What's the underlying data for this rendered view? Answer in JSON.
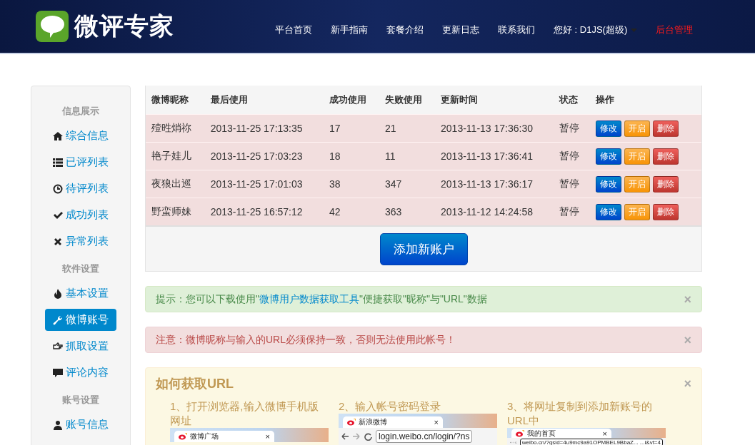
{
  "header": {
    "logo_text": "微评专家",
    "nav": [
      {
        "label": "平台首页",
        "kind": "link"
      },
      {
        "label": "新手指南",
        "kind": "link"
      },
      {
        "label": "套餐介绍",
        "kind": "link"
      },
      {
        "label": "更新日志",
        "kind": "link"
      },
      {
        "label": "联系我们",
        "kind": "link"
      },
      {
        "label": "您好 : D1JS(超级)",
        "kind": "user"
      },
      {
        "label": "后台管理",
        "kind": "admin"
      }
    ]
  },
  "sidebar": [
    {
      "heading": "信息展示",
      "items": [
        {
          "label": "综合信息",
          "kind": "home",
          "selected": false
        },
        {
          "label": "已评列表",
          "kind": "list",
          "selected": false
        },
        {
          "label": "待评列表",
          "kind": "clock",
          "selected": false
        },
        {
          "label": "成功列表",
          "kind": "check",
          "selected": false
        },
        {
          "label": "异常列表",
          "kind": "times",
          "selected": false
        }
      ]
    },
    {
      "heading": "软件设置",
      "items": [
        {
          "label": "基本设置",
          "kind": "fire",
          "selected": false
        },
        {
          "label": "微博账号",
          "kind": "wrench",
          "selected": true
        },
        {
          "label": "抓取设置",
          "kind": "hand",
          "selected": false
        },
        {
          "label": "评论内容",
          "kind": "comment",
          "selected": false
        }
      ]
    },
    {
      "heading": "账号设置",
      "items": [
        {
          "label": "账号信息",
          "kind": "user",
          "selected": false
        }
      ]
    }
  ],
  "table": {
    "columns": [
      "微博昵称",
      "最后使用",
      "成功使用",
      "失败使用",
      "更新时间",
      "状态",
      "操作"
    ],
    "rows": [
      {
        "cells": [
          "殪甠焇祢",
          "2013-11-25 17:13:35",
          "17",
          "21",
          "2013-11-13 17:36:30",
          "暂停"
        ],
        "actions": [
          {
            "label": "修改",
            "kind": "edit"
          },
          {
            "label": "开启",
            "kind": "start"
          },
          {
            "label": "删除",
            "kind": "delete"
          }
        ]
      },
      {
        "cells": [
          "艳子娃儿",
          "2013-11-25 17:03:23",
          "18",
          "11",
          "2013-11-13 17:36:41",
          "暂停"
        ],
        "actions": [
          {
            "label": "修改",
            "kind": "edit"
          },
          {
            "label": "开启",
            "kind": "start"
          },
          {
            "label": "删除",
            "kind": "delete"
          }
        ]
      },
      {
        "cells": [
          "夜狼出巡",
          "2013-11-25 17:01:03",
          "38",
          "347",
          "2013-11-13 17:36:17",
          "暂停"
        ],
        "actions": [
          {
            "label": "修改",
            "kind": "edit"
          },
          {
            "label": "开启",
            "kind": "start"
          },
          {
            "label": "删除",
            "kind": "delete"
          }
        ]
      },
      {
        "cells": [
          "野蛮师妹",
          "2013-11-25 16:57:12",
          "42",
          "363",
          "2013-11-12 14:24:58",
          "暂停"
        ],
        "actions": [
          {
            "label": "修改",
            "kind": "edit"
          },
          {
            "label": "开启",
            "kind": "start"
          },
          {
            "label": "删除",
            "kind": "delete"
          }
        ]
      }
    ],
    "add_button": "添加新账户"
  },
  "alerts": [
    {
      "kind": "success",
      "text_before": "提示：您可以下载使用\"",
      "link": "微博用户数据获取工具",
      "text_after": "\"便捷获取\"昵称\"与\"URL\"数据",
      "close": "×"
    },
    {
      "kind": "error",
      "text_before": "注意：微博昵称与输入的URL必须保持一致，否则无法使用此帐号！",
      "close": "×"
    }
  ],
  "guide": {
    "title": "如何获取URL",
    "close": "×",
    "steps": [
      {
        "text": "1、打开浏览器,输入微博手机版网址",
        "tab": "微博广场",
        "tab_close": "×"
      },
      {
        "text": "2、输入帐号密码登录",
        "tab": "新浪微博",
        "tab_close": "×",
        "address": "login.weibo.cn/login/?ns"
      },
      {
        "text": "3、将网址复制到添加新账号的URL中",
        "tab": "我的首页",
        "tab_close": "×",
        "address": "weibo.cn/?gsid=4u9mc9a91OPMBEL9BbaZ... ...i&vt=4"
      }
    ]
  }
}
